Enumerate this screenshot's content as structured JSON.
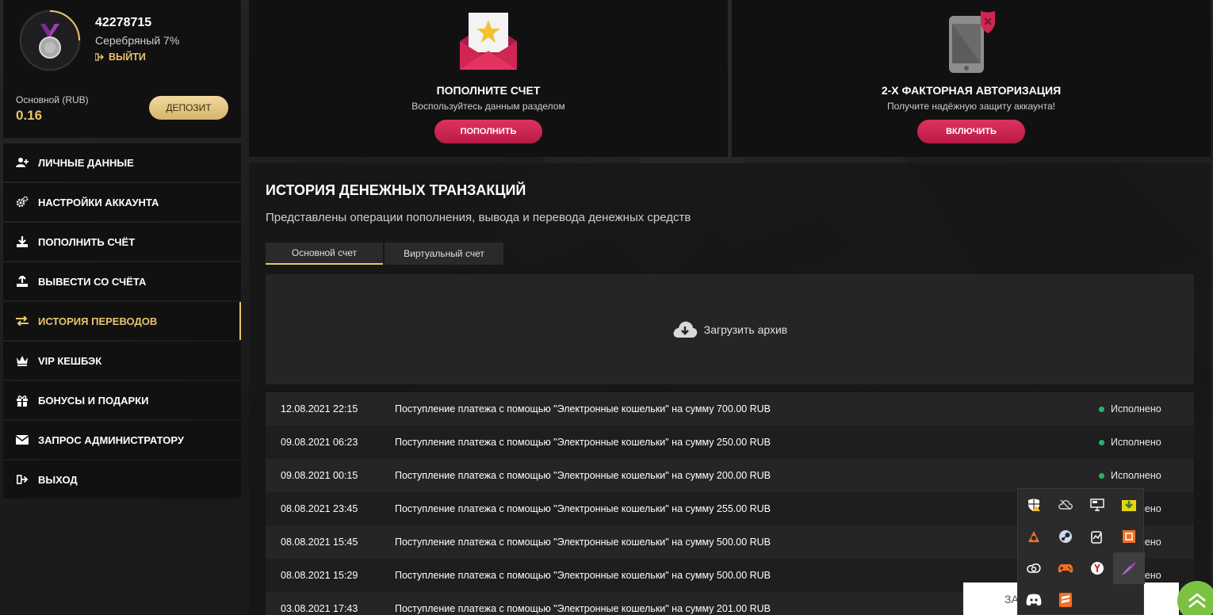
{
  "profile": {
    "username": "42278715",
    "level": "Серебряный 7%",
    "logout_link": "ВЫЙТИ",
    "account_label": "Основной (RUB)",
    "balance": "0.16",
    "deposit_button": "ДЕПОЗИТ"
  },
  "nav": {
    "items": [
      {
        "label": "ЛИЧНЫЕ ДАННЫЕ",
        "icon": "user-plus-icon"
      },
      {
        "label": "НАСТРОЙКИ АККАУНТА",
        "icon": "gears-icon"
      },
      {
        "label": "ПОПОЛНИТЬ СЧЁТ",
        "icon": "download-icon"
      },
      {
        "label": "ВЫВЕСТИ СО СЧЁТА",
        "icon": "upload-icon"
      },
      {
        "label": "ИСТОРИЯ ПЕРЕВОДОВ",
        "icon": "exchange-icon"
      },
      {
        "label": "VIP КЕШБЭК",
        "icon": "crown-icon"
      },
      {
        "label": "БОНУСЫ И ПОДАРКИ",
        "icon": "gift-icon"
      },
      {
        "label": "ЗАПРОС АДМИНИСТРАТОРУ",
        "icon": "envelope-icon"
      },
      {
        "label": "ВЫХОД",
        "icon": "sign-out-icon"
      }
    ],
    "active_index": 4
  },
  "cards": {
    "deposit": {
      "title": "ПОПОЛНИТЕ СЧЕТ",
      "subtitle": "Воспользуйтесь данным разделом",
      "button": "ПОПОЛНИТЬ"
    },
    "twofa": {
      "title": "2-Х ФАКТОРНАЯ АВТОРИЗАЦИЯ",
      "subtitle": "Получите надёжную защиту аккаунта!",
      "button": "ВКЛЮЧИТЬ"
    }
  },
  "history": {
    "title": "ИСТОРИЯ ДЕНЕЖНЫХ ТРАНЗАКЦИЙ",
    "description": "Представлены операции пополнения, вывода и перевода денежных средств",
    "tabs": [
      "Основной счет",
      "Виртуальный счет"
    ],
    "active_tab": 0,
    "archive_label": "Загрузить архив",
    "rows": [
      {
        "date": "12.08.2021 22:15",
        "description": "Поступление платежа с помощью \"Электронные кошельки\" на сумму 700.00 RUB",
        "status": "Исполнено"
      },
      {
        "date": "09.08.2021 06:23",
        "description": "Поступление платежа с помощью \"Электронные кошельки\" на сумму 250.00 RUB",
        "status": "Исполнено"
      },
      {
        "date": "09.08.2021 00:15",
        "description": "Поступление платежа с помощью \"Электронные кошельки\" на сумму 200.00 RUB",
        "status": "Исполнено"
      },
      {
        "date": "08.08.2021 23:45",
        "description": "Поступление платежа с помощью \"Электронные кошельки\" на сумму 255.00 RUB",
        "status": "Исполнено"
      },
      {
        "date": "08.08.2021 15:45",
        "description": "Поступление платежа с помощью \"Электронные кошельки\" на сумму 500.00 RUB",
        "status": "Исполнено"
      },
      {
        "date": "08.08.2021 15:29",
        "description": "Поступление платежа с помощью \"Электронные кошельки\" на сумму 500.00 RUB",
        "status": "Исполнено"
      },
      {
        "date": "03.08.2021 17:43",
        "description": "Поступление платежа с помощью \"Электронные кошельки\" на сумму 201.00 RUB",
        "status": ""
      }
    ]
  },
  "tray": {
    "icons": [
      "shield-warning-icon",
      "cloud-off-icon",
      "monitor-icon",
      "download-box-icon",
      "avast-icon",
      "steam-icon",
      "monitoring-icon",
      "square-orange-icon",
      "creative-cloud-icon",
      "gamepad-icon",
      "yandex-icon",
      "feather-icon",
      "discord-icon",
      "sublime-icon"
    ]
  },
  "chat": {
    "text": "ЗА"
  },
  "colors": {
    "gold": "#e8c46b",
    "pink": "#d02752",
    "green": "#26b36b",
    "panel": "#111112"
  }
}
